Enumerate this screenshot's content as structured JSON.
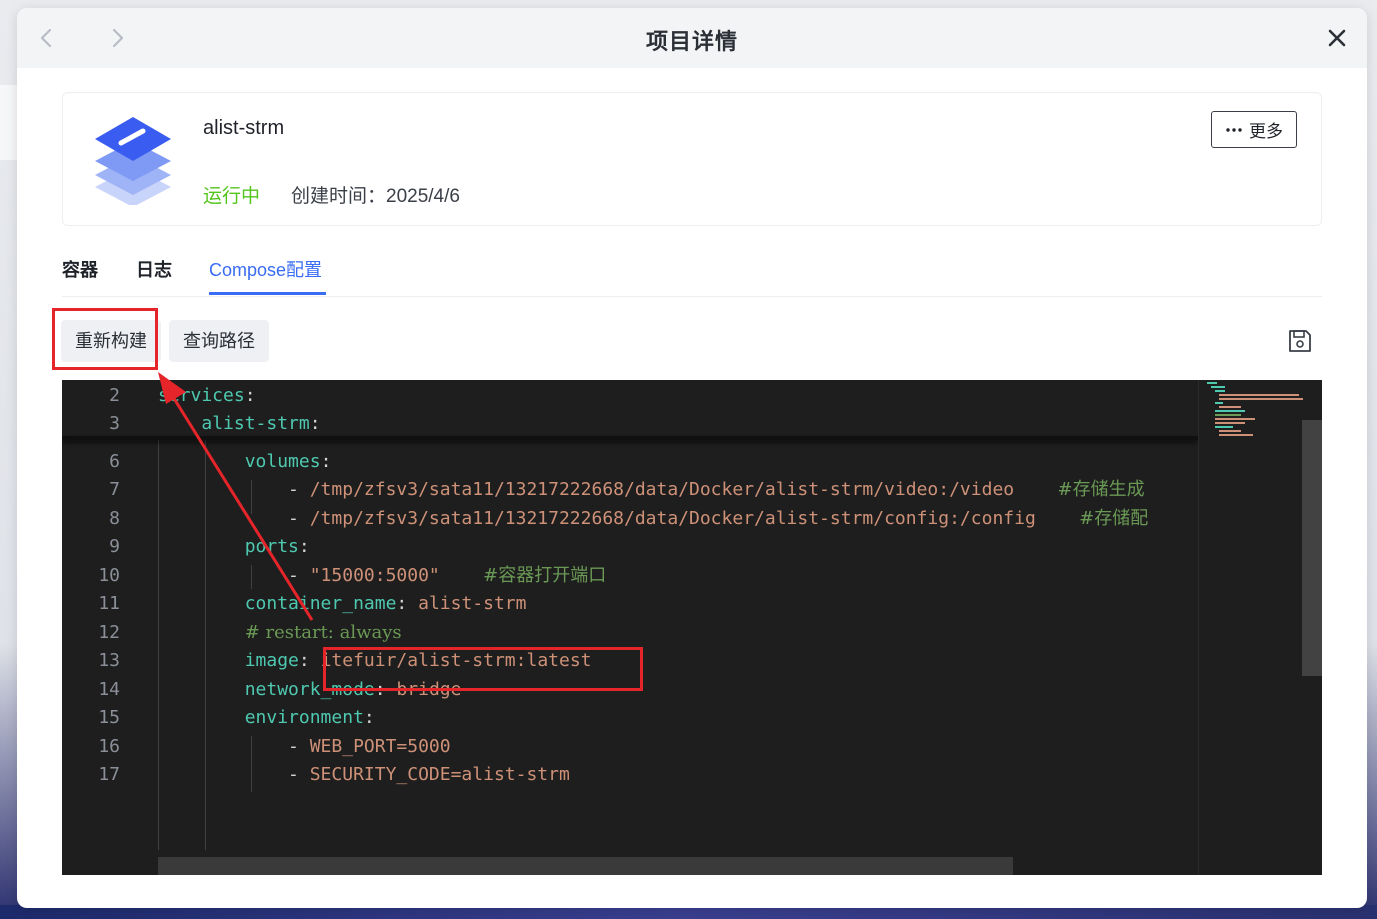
{
  "dialog": {
    "title": "项目详情"
  },
  "project": {
    "name": "alist-strm",
    "status": "运行中",
    "created": "创建时间：2025/4/6",
    "more_label": "更多"
  },
  "tabs": [
    {
      "label": "容器"
    },
    {
      "label": "日志"
    },
    {
      "label": "Compose配置",
      "active": true
    }
  ],
  "toolbar": {
    "rebuild_label": "重新构建",
    "query_path_label": "查询路径"
  },
  "editor": {
    "lines": [
      {
        "n": "2",
        "segs": [
          {
            "t": "services",
            "c": "key"
          },
          {
            "t": ":",
            "c": "plain"
          }
        ]
      },
      {
        "n": "3",
        "segs": [
          {
            "t": "    ",
            "c": "plain"
          },
          {
            "t": "alist-strm",
            "c": "key"
          },
          {
            "t": ":",
            "c": "plain"
          }
        ]
      },
      {
        "n": "6",
        "segs": [
          {
            "t": "        ",
            "c": "plain"
          },
          {
            "t": "volumes",
            "c": "key"
          },
          {
            "t": ":",
            "c": "plain"
          }
        ]
      },
      {
        "n": "7",
        "segs": [
          {
            "t": "            - ",
            "c": "plain"
          },
          {
            "t": "/tmp/zfsv3/sata11/13217222668/data/Docker/alist-strm/video:/video",
            "c": "str"
          },
          {
            "t": "    ",
            "c": "plain"
          },
          {
            "t": "#存储生成",
            "c": "cmt"
          }
        ]
      },
      {
        "n": "8",
        "segs": [
          {
            "t": "            - ",
            "c": "plain"
          },
          {
            "t": "/tmp/zfsv3/sata11/13217222668/data/Docker/alist-strm/config:/config",
            "c": "str"
          },
          {
            "t": "    ",
            "c": "plain"
          },
          {
            "t": "#存储配",
            "c": "cmt"
          }
        ]
      },
      {
        "n": "9",
        "segs": [
          {
            "t": "        ",
            "c": "plain"
          },
          {
            "t": "ports",
            "c": "key"
          },
          {
            "t": ":",
            "c": "plain"
          }
        ]
      },
      {
        "n": "10",
        "segs": [
          {
            "t": "            - ",
            "c": "plain"
          },
          {
            "t": "\"15000:5000\"",
            "c": "str"
          },
          {
            "t": "    ",
            "c": "plain"
          },
          {
            "t": "#容器打开端口",
            "c": "cmt"
          }
        ]
      },
      {
        "n": "11",
        "segs": [
          {
            "t": "        ",
            "c": "plain"
          },
          {
            "t": "container_name",
            "c": "key"
          },
          {
            "t": ": ",
            "c": "plain"
          },
          {
            "t": "alist-strm",
            "c": "str"
          }
        ]
      },
      {
        "n": "12",
        "segs": [
          {
            "t": "        ",
            "c": "plain"
          },
          {
            "t": "# restart: always",
            "c": "cmt"
          }
        ]
      },
      {
        "n": "13",
        "segs": [
          {
            "t": "        ",
            "c": "plain"
          },
          {
            "t": "image",
            "c": "key"
          },
          {
            "t": ": ",
            "c": "plain"
          },
          {
            "t": "itefuir/alist-strm:latest",
            "c": "str"
          }
        ]
      },
      {
        "n": "14",
        "segs": [
          {
            "t": "        ",
            "c": "plain"
          },
          {
            "t": "network_mode",
            "c": "key"
          },
          {
            "t": ": ",
            "c": "plain"
          },
          {
            "t": "bridge",
            "c": "str"
          }
        ]
      },
      {
        "n": "15",
        "segs": [
          {
            "t": "        ",
            "c": "plain"
          },
          {
            "t": "environment",
            "c": "key"
          },
          {
            "t": ":",
            "c": "plain"
          }
        ]
      },
      {
        "n": "16",
        "segs": [
          {
            "t": "            - ",
            "c": "plain"
          },
          {
            "t": "WEB_PORT=5000",
            "c": "str"
          }
        ]
      },
      {
        "n": "17",
        "segs": [
          {
            "t": "            - ",
            "c": "plain"
          },
          {
            "t": "SECURITY_CODE=alist-strm",
            "c": "str"
          }
        ]
      }
    ]
  },
  "colors": {
    "accent": "#3a6cf4",
    "status_running": "#52c41a",
    "highlight": "#e5252a",
    "editor_bg": "#1e1e1e",
    "yaml_key": "#4ec9b0",
    "yaml_string": "#ce9178",
    "yaml_comment": "#6a9955"
  },
  "icons": {
    "back": "chevron-left-icon",
    "forward": "chevron-right-icon",
    "close": "close-icon",
    "more": "ellipsis-icon",
    "save": "save-icon",
    "logo": "stacked-layers-logo"
  }
}
